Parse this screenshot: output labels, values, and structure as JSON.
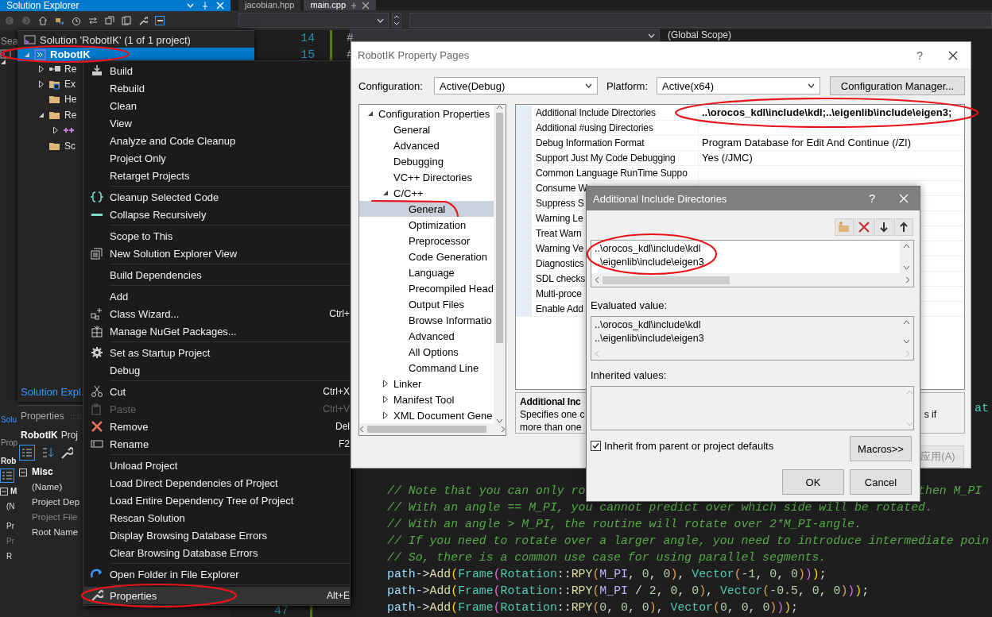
{
  "back_panel": {
    "title": "Solution Explorer",
    "search": "Sea",
    "tab": "Solu",
    "properties_title": "Prop",
    "object": "Rob",
    "category": "M",
    "rows": [
      {
        "label": "(N",
        "disabled": false
      },
      {
        "label": "Pr",
        "disabled": false
      },
      {
        "label": "Pr",
        "disabled": true
      },
      {
        "label": "R",
        "disabled": false
      }
    ]
  },
  "editor": {
    "tabs": [
      {
        "label": "jacobian.hpp",
        "selected": false
      },
      {
        "label": "main.cpp",
        "selected": true
      }
    ],
    "scope": "(Global Scope)",
    "top_line_numbers": [
      "14",
      "15"
    ],
    "top_code": [
      "#",
      "#"
    ],
    "bottom_line_number": "47",
    "fragment": "at",
    "lines": [
      {
        "tokens": [
          {
            "kind": "comment",
            "text": "// Note that you can only ro"
          }
        ],
        "tail": [
          {
            "kind": "comment",
            "text": "then M_PI"
          }
        ]
      },
      {
        "tokens": [
          {
            "kind": "comment",
            "text": "// With an angle == M_PI, you cannot predict over which side will be rotated."
          }
        ]
      },
      {
        "tokens": [
          {
            "kind": "comment",
            "text": "// With an angle > M_PI, the routine will rotate over 2*M_PI-angle."
          }
        ]
      },
      {
        "tokens": [
          {
            "kind": "comment",
            "text": "// If you need to rotate over a larger angle, you need to introduce intermediate poin"
          }
        ]
      },
      {
        "tokens": [
          {
            "kind": "comment",
            "text": "// So, there is a common use case for using parallel segments."
          }
        ]
      },
      {
        "tokens": [
          {
            "kind": "ident",
            "text": "path"
          },
          {
            "kind": "op",
            "text": "->"
          },
          {
            "kind": "func",
            "text": "Add"
          },
          {
            "kind": "b1",
            "text": "("
          },
          {
            "kind": "type",
            "text": "Frame"
          },
          {
            "kind": "b2",
            "text": "("
          },
          {
            "kind": "type",
            "text": "Rotation"
          },
          {
            "kind": "op",
            "text": "::"
          },
          {
            "kind": "func",
            "text": "RPY"
          },
          {
            "kind": "b3",
            "text": "("
          },
          {
            "kind": "macro",
            "text": "M_PI"
          },
          {
            "kind": "op",
            "text": ", "
          },
          {
            "kind": "num",
            "text": "0"
          },
          {
            "kind": "op",
            "text": ", "
          },
          {
            "kind": "num",
            "text": "0"
          },
          {
            "kind": "b3",
            "text": ")"
          },
          {
            "kind": "op",
            "text": ", "
          },
          {
            "kind": "type",
            "text": "Vector"
          },
          {
            "kind": "b3",
            "text": "("
          },
          {
            "kind": "num",
            "text": "-1"
          },
          {
            "kind": "op",
            "text": ", "
          },
          {
            "kind": "num",
            "text": "0"
          },
          {
            "kind": "op",
            "text": ", "
          },
          {
            "kind": "num",
            "text": "0"
          },
          {
            "kind": "b3",
            "text": ")"
          },
          {
            "kind": "b2",
            "text": ")"
          },
          {
            "kind": "b1",
            "text": ")"
          },
          {
            "kind": "op",
            "text": ";"
          }
        ]
      },
      {
        "tokens": [
          {
            "kind": "ident",
            "text": "path"
          },
          {
            "kind": "op",
            "text": "->"
          },
          {
            "kind": "func",
            "text": "Add"
          },
          {
            "kind": "b1",
            "text": "("
          },
          {
            "kind": "type",
            "text": "Frame"
          },
          {
            "kind": "b2",
            "text": "("
          },
          {
            "kind": "type",
            "text": "Rotation"
          },
          {
            "kind": "op",
            "text": "::"
          },
          {
            "kind": "func",
            "text": "RPY"
          },
          {
            "kind": "b3",
            "text": "("
          },
          {
            "kind": "macro",
            "text": "M_PI"
          },
          {
            "kind": "op",
            "text": " / "
          },
          {
            "kind": "num",
            "text": "2"
          },
          {
            "kind": "op",
            "text": ", "
          },
          {
            "kind": "num",
            "text": "0"
          },
          {
            "kind": "op",
            "text": ", "
          },
          {
            "kind": "num",
            "text": "0"
          },
          {
            "kind": "b3",
            "text": ")"
          },
          {
            "kind": "op",
            "text": ", "
          },
          {
            "kind": "type",
            "text": "Vector"
          },
          {
            "kind": "b3",
            "text": "("
          },
          {
            "kind": "num",
            "text": "-0.5"
          },
          {
            "kind": "op",
            "text": ", "
          },
          {
            "kind": "num",
            "text": "0"
          },
          {
            "kind": "op",
            "text": ", "
          },
          {
            "kind": "num",
            "text": "0"
          },
          {
            "kind": "b3",
            "text": ")"
          },
          {
            "kind": "b2",
            "text": ")"
          },
          {
            "kind": "b1",
            "text": ")"
          },
          {
            "kind": "op",
            "text": ";"
          }
        ]
      },
      {
        "tokens": [
          {
            "kind": "ident",
            "text": "path"
          },
          {
            "kind": "op",
            "text": "->"
          },
          {
            "kind": "func",
            "text": "Add"
          },
          {
            "kind": "b1",
            "text": "("
          },
          {
            "kind": "type",
            "text": "Frame"
          },
          {
            "kind": "b2",
            "text": "("
          },
          {
            "kind": "type",
            "text": "Rotation"
          },
          {
            "kind": "op",
            "text": "::"
          },
          {
            "kind": "func",
            "text": "RPY"
          },
          {
            "kind": "b3",
            "text": "("
          },
          {
            "kind": "num",
            "text": "0"
          },
          {
            "kind": "op",
            "text": ", "
          },
          {
            "kind": "num",
            "text": "0"
          },
          {
            "kind": "op",
            "text": ", "
          },
          {
            "kind": "num",
            "text": "0"
          },
          {
            "kind": "b3",
            "text": ")"
          },
          {
            "kind": "op",
            "text": ", "
          },
          {
            "kind": "type",
            "text": "Vector"
          },
          {
            "kind": "b3",
            "text": "("
          },
          {
            "kind": "num",
            "text": "0"
          },
          {
            "kind": "op",
            "text": ", "
          },
          {
            "kind": "num",
            "text": "0"
          },
          {
            "kind": "op",
            "text": ", "
          },
          {
            "kind": "num",
            "text": "0"
          },
          {
            "kind": "b3",
            "text": ")"
          },
          {
            "kind": "b2",
            "text": ")"
          },
          {
            "kind": "b1",
            "text": ")"
          },
          {
            "kind": "op",
            "text": ";"
          }
        ]
      }
    ]
  },
  "solution_explorer": {
    "tab": "Solution Expl.",
    "tree": [
      {
        "label": "Solution 'RobotIK' (1 of 1 project)",
        "kind": "solution",
        "selected": false
      },
      {
        "label": "RobotIK",
        "kind": "project",
        "selected": true,
        "expanded": true,
        "children": [
          {
            "label": "Re",
            "kind": "references",
            "selected": false,
            "expanded": false
          },
          {
            "label": "Ex",
            "kind": "external",
            "selected": false,
            "expanded": false
          },
          {
            "label": "He",
            "kind": "folder",
            "selected": false
          },
          {
            "label": "Re",
            "kind": "folder",
            "selected": false,
            "expanded": true,
            "children": [
              {
                "kind": "cpp",
                "selected": false,
                "expanded": false
              }
            ]
          },
          {
            "label": "Sc",
            "kind": "folder",
            "selected": false
          }
        ]
      }
    ]
  },
  "properties": {
    "title": "Properties",
    "object": "RobotIK",
    "object_type": "Proj",
    "category": "Misc",
    "rows": [
      {
        "label": "(Name)",
        "disabled": false
      },
      {
        "label": "Project Dep",
        "disabled": false
      },
      {
        "label": "Project File",
        "disabled": true
      },
      {
        "label": "Root Name",
        "disabled": false
      }
    ]
  },
  "context_menu": {
    "items": [
      {
        "kind": "command",
        "label": "Build",
        "selected": false,
        "disabled": false
      },
      {
        "kind": "command",
        "label": "Rebuild",
        "selected": false,
        "disabled": false
      },
      {
        "kind": "command",
        "label": "Clean",
        "selected": false,
        "disabled": false
      },
      {
        "kind": "command",
        "label": "View",
        "selected": false,
        "disabled": false
      },
      {
        "kind": "command",
        "label": "Analyze and Code Cleanup",
        "selected": false,
        "disabled": false
      },
      {
        "kind": "command",
        "label": "Project Only",
        "selected": false,
        "disabled": false
      },
      {
        "kind": "command",
        "label": "Retarget Projects",
        "selected": false,
        "disabled": false
      },
      {
        "kind": "separator"
      },
      {
        "kind": "command",
        "label": "Cleanup Selected Code",
        "selected": false,
        "disabled": false
      },
      {
        "kind": "command",
        "label": "Collapse Recursively",
        "selected": false,
        "disabled": false
      },
      {
        "kind": "separator"
      },
      {
        "kind": "command",
        "label": "Scope to This",
        "selected": false,
        "disabled": false
      },
      {
        "kind": "command",
        "label": "New Solution Explorer View",
        "selected": false,
        "disabled": false
      },
      {
        "kind": "separator"
      },
      {
        "kind": "command",
        "label": "Build Dependencies",
        "selected": false,
        "disabled": false
      },
      {
        "kind": "separator"
      },
      {
        "kind": "command",
        "label": "Add",
        "selected": false,
        "disabled": false
      },
      {
        "kind": "command",
        "label": "Class Wizard...",
        "shortcut": "Ctrl+",
        "selected": false,
        "disabled": false
      },
      {
        "kind": "command",
        "label": "Manage NuGet Packages...",
        "selected": false,
        "disabled": false
      },
      {
        "kind": "separator"
      },
      {
        "kind": "command",
        "label": "Set as Startup Project",
        "selected": false,
        "disabled": false
      },
      {
        "kind": "command",
        "label": "Debug",
        "selected": false,
        "disabled": false
      },
      {
        "kind": "separator"
      },
      {
        "kind": "command",
        "label": "Cut",
        "shortcut": "Ctrl+X",
        "selected": false,
        "disabled": false
      },
      {
        "kind": "command",
        "label": "Paste",
        "shortcut": "Ctrl+V",
        "selected": false,
        "disabled": true
      },
      {
        "kind": "command",
        "label": "Remove",
        "shortcut": "Del",
        "selected": false,
        "disabled": false
      },
      {
        "kind": "command",
        "label": "Rename",
        "shortcut": "F2",
        "selected": false,
        "disabled": false
      },
      {
        "kind": "separator"
      },
      {
        "kind": "command",
        "label": "Unload Project",
        "selected": false,
        "disabled": false
      },
      {
        "kind": "command",
        "label": "Load Direct Dependencies of Project",
        "selected": false,
        "disabled": false
      },
      {
        "kind": "command",
        "label": "Load Entire Dependency Tree of Project",
        "selected": false,
        "disabled": false
      },
      {
        "kind": "command",
        "label": "Rescan Solution",
        "selected": false,
        "disabled": false
      },
      {
        "kind": "command",
        "label": "Display Browsing Database Errors",
        "selected": false,
        "disabled": false
      },
      {
        "kind": "command",
        "label": "Clear Browsing Database Errors",
        "selected": false,
        "disabled": false
      },
      {
        "kind": "separator"
      },
      {
        "kind": "command",
        "label": "Open Folder in File Explorer",
        "selected": false,
        "disabled": false
      },
      {
        "kind": "separator"
      },
      {
        "kind": "command",
        "label": "Properties",
        "shortcut": "Alt+E",
        "selected": true,
        "disabled": false
      }
    ]
  },
  "property_pages": {
    "title": "RobotIK Property Pages",
    "help": "?",
    "configuration_label": "Configuration:",
    "configuration": "Active(Debug)",
    "platform_label": "Platform:",
    "platform": "Active(x64)",
    "manager_button": "Configuration Manager...",
    "tree": [
      {
        "label": "Configuration Properties",
        "selected": false,
        "expanded": true,
        "children": [
          {
            "label": "General",
            "selected": false
          },
          {
            "label": "Advanced",
            "selected": false
          },
          {
            "label": "Debugging",
            "selected": false
          },
          {
            "label": "VC++ Directories",
            "selected": false
          },
          {
            "label": "C/C++",
            "selected": false,
            "expanded": true,
            "children": [
              {
                "label": "General",
                "selected": true
              },
              {
                "label": "Optimization",
                "selected": false
              },
              {
                "label": "Preprocessor",
                "selected": false
              },
              {
                "label": "Code Generation",
                "selected": false
              },
              {
                "label": "Language",
                "selected": false
              },
              {
                "label": "Precompiled Head",
                "selected": false
              },
              {
                "label": "Output Files",
                "selected": false
              },
              {
                "label": "Browse Informatio",
                "selected": false
              },
              {
                "label": "Advanced",
                "selected": false
              },
              {
                "label": "All Options",
                "selected": false
              },
              {
                "label": "Command Line",
                "selected": false
              }
            ]
          },
          {
            "label": "Linker",
            "selected": false,
            "expanded": false
          },
          {
            "label": "Manifest Tool",
            "selected": false,
            "expanded": false
          },
          {
            "label": "XML Document Gene",
            "selected": false,
            "expanded": false
          }
        ]
      }
    ],
    "grid": [
      {
        "name": "Additional Include Directories",
        "value": "..\\orocos_kdl\\include\\kdl;..\\eigenlib\\include\\eigen3;",
        "modified": true
      },
      {
        "name": "Additional #using Directories",
        "modified": false
      },
      {
        "name": "Debug Information Format",
        "value": "Program Database for Edit And Continue (/ZI)",
        "modified": false
      },
      {
        "name": "Support Just My Code Debugging",
        "value": "Yes (/JMC)",
        "modified": false
      },
      {
        "name": "Common Language RunTime Suppo",
        "modified": false
      },
      {
        "name": "Consume W",
        "modified": false
      },
      {
        "name": "Suppress S",
        "modified": false
      },
      {
        "name": "Warning Le",
        "modified": false
      },
      {
        "name": "Treat Warn",
        "modified": false
      },
      {
        "name": "Warning Ve",
        "modified": false
      },
      {
        "name": "Diagnostics",
        "modified": false
      },
      {
        "name": "SDL checks",
        "modified": false
      },
      {
        "name": "Multi-proce",
        "modified": false
      },
      {
        "name": "Enable Add",
        "modified": false
      }
    ],
    "description_title": "Additional Inc",
    "description_lines": [
      "Specifies one c",
      "more than one"
    ],
    "description_tail": "s if",
    "apply_button": {
      "label": "应用(A)",
      "disabled": true
    }
  },
  "include_dialog": {
    "title": "Additional Include Directories",
    "help": "?",
    "entries": [
      "..\\orocos_kdl\\include\\kdl",
      "..\\eigenlib\\include\\eigen3"
    ],
    "evaluated_label": "Evaluated value:",
    "evaluated": [
      "..\\orocos_kdl\\include\\kdl",
      "..\\eigenlib\\include\\eigen3"
    ],
    "inherited_label": "Inherited values:",
    "inherit": {
      "label": "Inherit from parent or project defaults",
      "checked": true
    },
    "macros_button": "Macros>>",
    "ok_button": "OK",
    "cancel_button": "Cancel"
  }
}
